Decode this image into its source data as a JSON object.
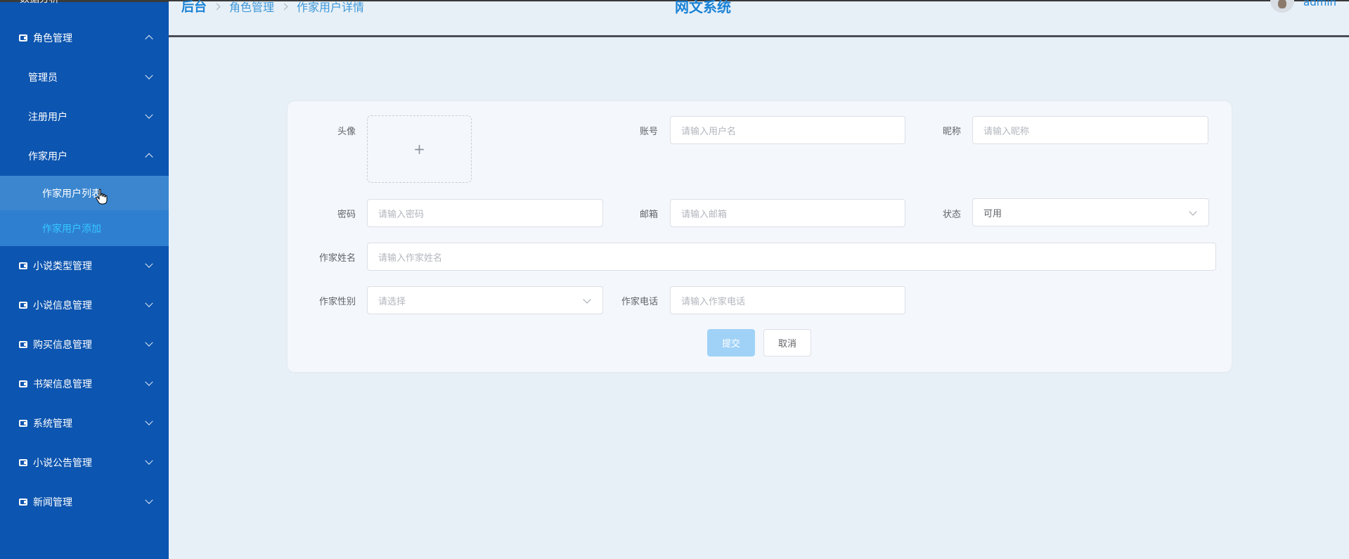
{
  "sidebar": {
    "top_cut_label": "数据分析",
    "items": [
      {
        "label": "角色管理",
        "level": 0,
        "expanded": true
      },
      {
        "label": "管理员",
        "level": 1,
        "expanded": false
      },
      {
        "label": "注册用户",
        "level": 1,
        "expanded": false
      },
      {
        "label": "作家用户",
        "level": 1,
        "expanded": true
      },
      {
        "label": "作家用户列表",
        "level": 2
      },
      {
        "label": "作家用户添加",
        "level": 2
      },
      {
        "label": "小说类型管理",
        "level": 0,
        "expanded": false
      },
      {
        "label": "小说信息管理",
        "level": 0,
        "expanded": false
      },
      {
        "label": "购买信息管理",
        "level": 0,
        "expanded": false
      },
      {
        "label": "书架信息管理",
        "level": 0,
        "expanded": false
      },
      {
        "label": "系统管理",
        "level": 0,
        "expanded": false
      },
      {
        "label": "小说公告管理",
        "level": 0,
        "expanded": false
      },
      {
        "label": "新闻管理",
        "level": 0,
        "expanded": false
      }
    ]
  },
  "header": {
    "breadcrumb": [
      "后台",
      "角色管理",
      "作家用户详情"
    ],
    "title": "网文系统",
    "username": "admin"
  },
  "form": {
    "avatar_label": "头像",
    "upload_plus": "+",
    "account_label": "账号",
    "account_placeholder": "请输入用户名",
    "nickname_label": "昵称",
    "nickname_placeholder": "请输入昵称",
    "password_label": "密码",
    "password_placeholder": "请输入密码",
    "email_label": "邮箱",
    "email_placeholder": "请输入邮箱",
    "status_label": "状态",
    "status_value": "可用",
    "writer_name_label": "作家姓名",
    "writer_name_placeholder": "请输入作家姓名",
    "gender_label": "作家性别",
    "gender_placeholder": "请选择",
    "phone_label": "作家电话",
    "phone_placeholder": "请输入作家电话",
    "submit_label": "提交",
    "cancel_label": "取消"
  },
  "colors": {
    "sidebar_bg": "#0c55b0",
    "sidebar_active": "#3b86cf",
    "accent": "#1a82d6",
    "page_bg": "#e8f0f7"
  }
}
